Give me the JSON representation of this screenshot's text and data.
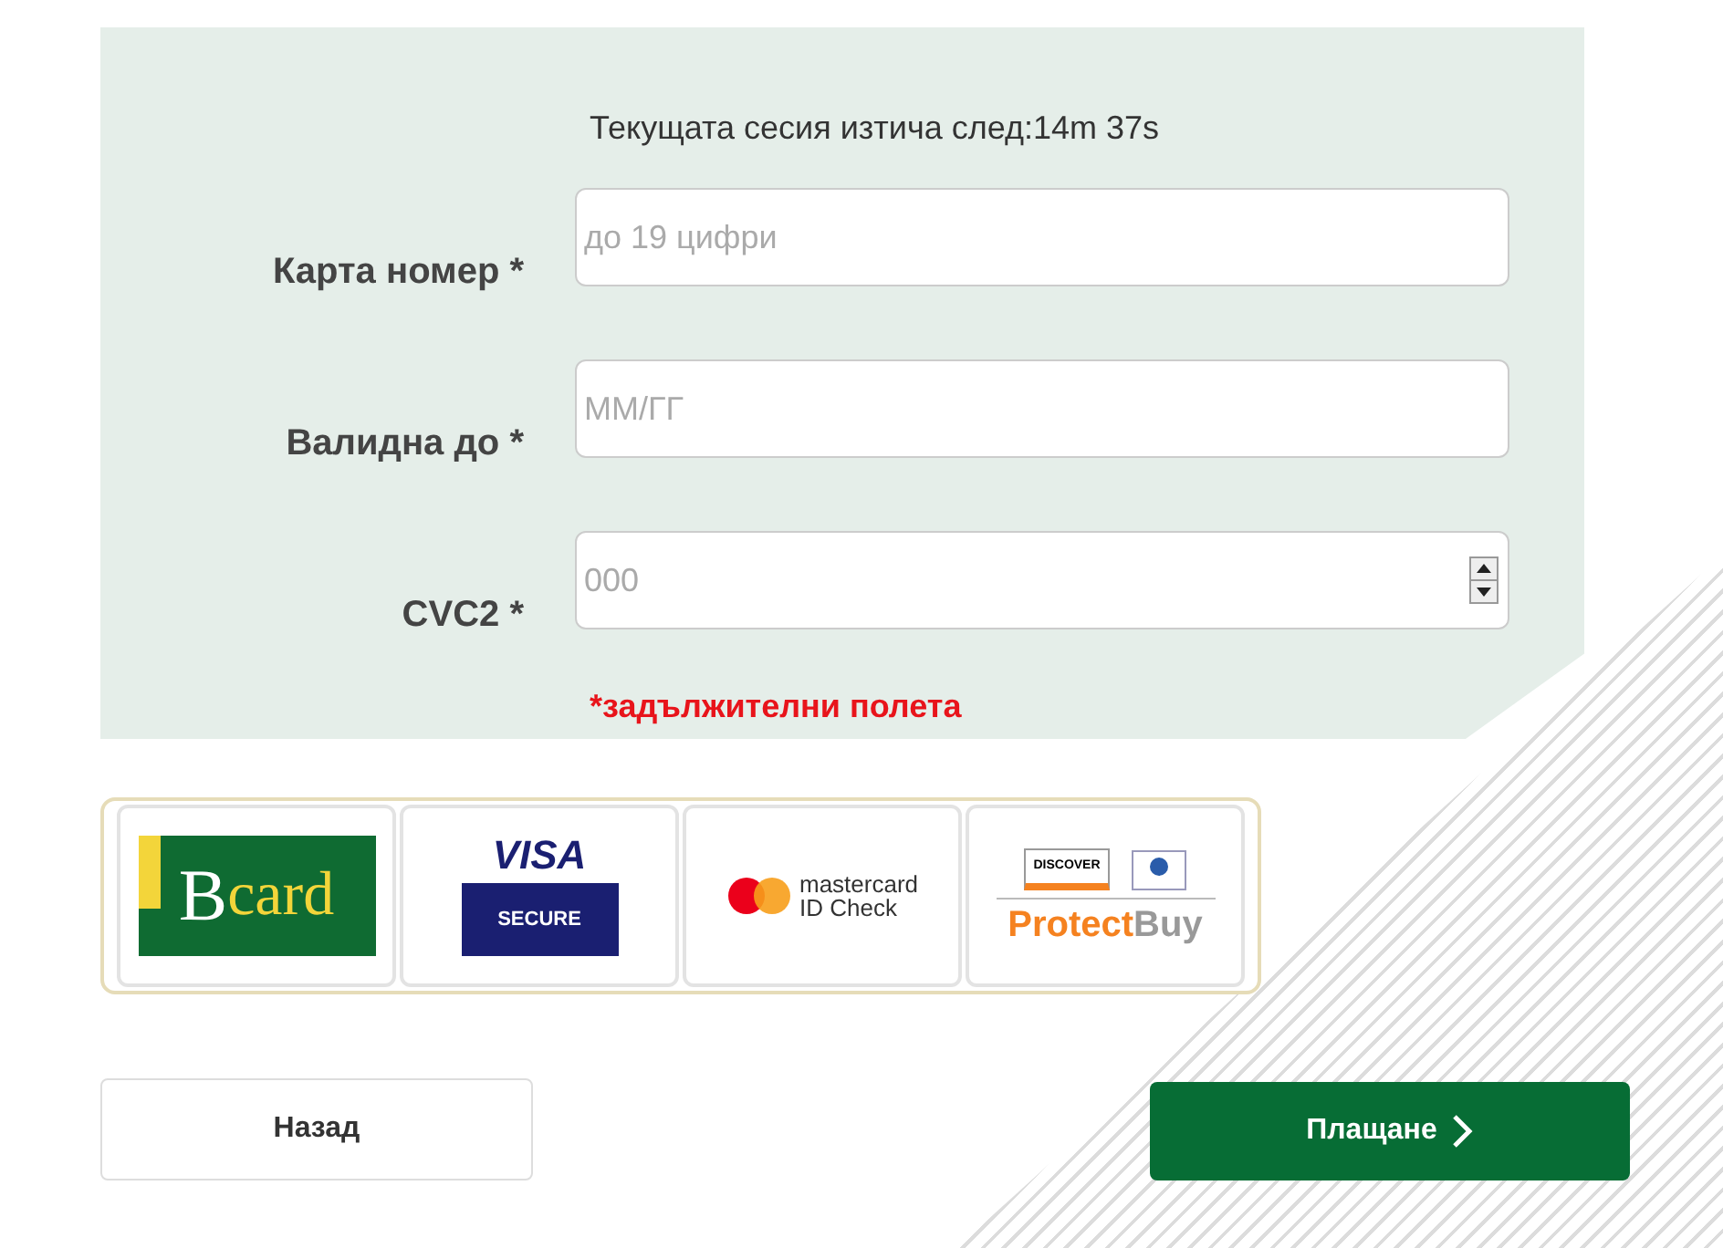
{
  "session": {
    "label": "Текущата сесия изтича след:",
    "time": "14m 37s"
  },
  "fields": [
    {
      "label": "Карта номер *",
      "placeholder": "до 19 цифри",
      "kind": "text"
    },
    {
      "label": "Валидна до *",
      "placeholder": "ММ/ГГ",
      "kind": "text"
    },
    {
      "label": "CVC2 *",
      "placeholder": "000",
      "kind": "number"
    }
  ],
  "required_note": "*задължителни полета",
  "logos": [
    {
      "kind": "bcard",
      "texts": [
        "B",
        "card"
      ]
    },
    {
      "kind": "visa",
      "texts": [
        "VISA",
        "SECURE"
      ]
    },
    {
      "kind": "mastercard",
      "texts": [
        "mastercard",
        "ID Check"
      ]
    },
    {
      "kind": "protectbuy",
      "texts": [
        "DISCOVER",
        "Protect",
        "Buy"
      ]
    }
  ],
  "buttons": {
    "back": "Назад",
    "pay": "Плащане"
  }
}
